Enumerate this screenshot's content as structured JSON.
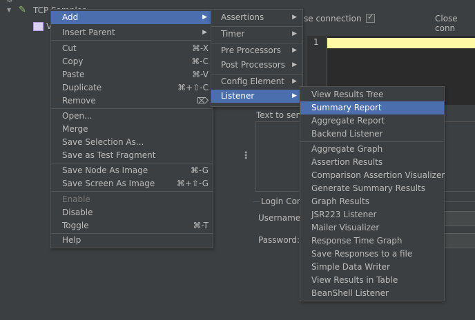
{
  "tree": {
    "gear_icon": "gear-icon",
    "sampler_label": "TCP Sampler",
    "child_label": "V"
  },
  "right": {
    "close_connection_label_1": "se connection",
    "close_connection_label_2": "Close conn",
    "line_number": "1",
    "text_to_send_label": "Text to sen",
    "login_config_label": "Login Con",
    "username_label": "Username",
    "password_label": "Password:"
  },
  "main_menu": {
    "items": [
      {
        "label": "Add",
        "shortcut": "",
        "submenu": true
      },
      {
        "label": "Insert Parent",
        "shortcut": "",
        "submenu": true
      },
      {
        "label": "Cut",
        "shortcut": "⌘-X"
      },
      {
        "label": "Copy",
        "shortcut": "⌘-C"
      },
      {
        "label": "Paste",
        "shortcut": "⌘-V"
      },
      {
        "label": "Duplicate",
        "shortcut": "⌘+⇧-C"
      },
      {
        "label": "Remove",
        "shortcut": "⌦"
      },
      {
        "label": "Open...",
        "shortcut": ""
      },
      {
        "label": "Merge",
        "shortcut": ""
      },
      {
        "label": "Save Selection As...",
        "shortcut": ""
      },
      {
        "label": "Save as Test Fragment",
        "shortcut": ""
      },
      {
        "label": "Save Node As Image",
        "shortcut": "⌘-G"
      },
      {
        "label": "Save Screen As Image",
        "shortcut": "⌘+⇧-G"
      },
      {
        "label": "Enable",
        "shortcut": "",
        "disabled": true
      },
      {
        "label": "Disable",
        "shortcut": ""
      },
      {
        "label": "Toggle",
        "shortcut": "⌘-T"
      },
      {
        "label": "Help",
        "shortcut": ""
      }
    ]
  },
  "add_menu": {
    "items": [
      {
        "label": "Assertions"
      },
      {
        "label": "Timer"
      },
      {
        "label": "Pre Processors"
      },
      {
        "label": "Post Processors"
      },
      {
        "label": "Config Element"
      },
      {
        "label": "Listener"
      }
    ]
  },
  "listener_menu": {
    "items": [
      {
        "label": "View Results Tree"
      },
      {
        "label": "Summary Report"
      },
      {
        "label": "Aggregate Report"
      },
      {
        "label": "Backend Listener"
      },
      {
        "label": "Aggregate Graph"
      },
      {
        "label": "Assertion Results"
      },
      {
        "label": "Comparison Assertion Visualizer"
      },
      {
        "label": "Generate Summary Results"
      },
      {
        "label": "Graph Results"
      },
      {
        "label": "JSR223 Listener"
      },
      {
        "label": "Mailer Visualizer"
      },
      {
        "label": "Response Time Graph"
      },
      {
        "label": "Save Responses to a file"
      },
      {
        "label": "Simple Data Writer"
      },
      {
        "label": "View Results in Table"
      },
      {
        "label": "BeanShell Listener"
      }
    ]
  },
  "colors": {
    "background": "#3c3f41",
    "selection": "#4b6eaf",
    "editor_highlight": "#fff9a6"
  }
}
